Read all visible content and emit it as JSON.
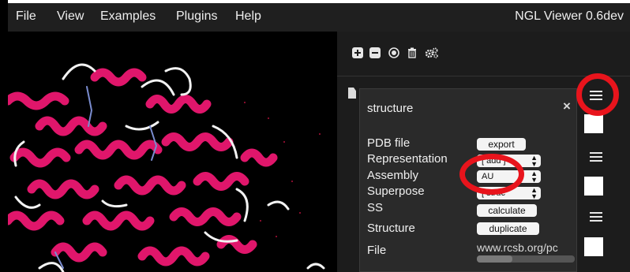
{
  "menubar": {
    "items": [
      "File",
      "View",
      "Examples",
      "Plugins",
      "Help"
    ],
    "app_title": "NGL Viewer 0.6dev"
  },
  "sidebar": {
    "toolbar_icons": [
      "add-icon",
      "remove-icon",
      "center-icon",
      "trash-icon",
      "settings-icon"
    ]
  },
  "popup": {
    "title": "structure",
    "close": "×",
    "rows": {
      "pdb_file": {
        "label": "PDB file",
        "button": "export"
      },
      "representation": {
        "label": "Representation",
        "value": "[ add ]"
      },
      "assembly": {
        "label": "Assembly",
        "value": "AU"
      },
      "superpose": {
        "label": "Superpose",
        "value": "[ struc"
      },
      "ss": {
        "label": "SS",
        "button": "calculate"
      },
      "structure": {
        "label": "Structure",
        "button": "duplicate"
      },
      "file": {
        "label": "File",
        "value": "www.rcsb.org/pc",
        "progress": 0.36
      }
    }
  },
  "colors": {
    "ribbon": "#e0166b",
    "annotation": "#e8141c",
    "panel_bg": "#2a2a2a",
    "sidebar_bg": "#1c1c1c"
  }
}
